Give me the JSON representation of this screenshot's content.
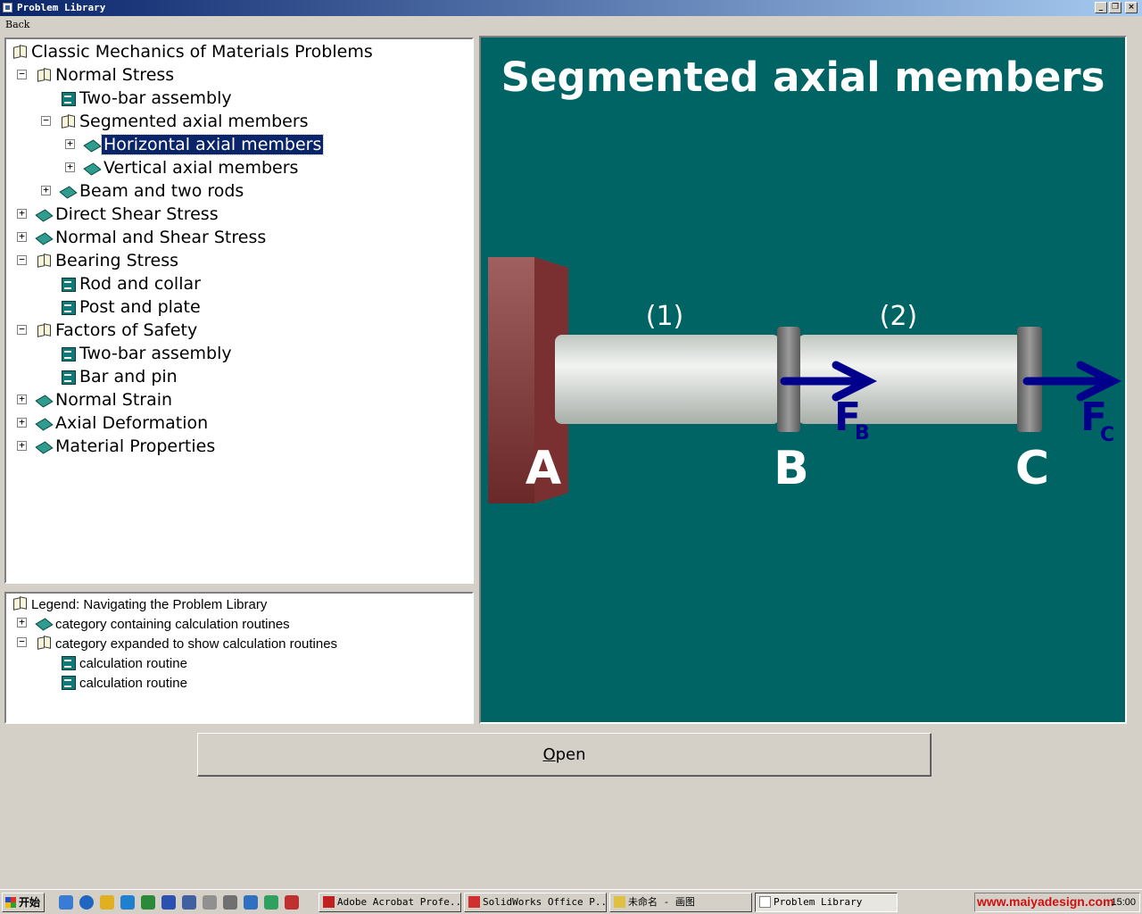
{
  "window": {
    "title": "Problem Library"
  },
  "menu": {
    "back": "Back"
  },
  "tree": [
    {
      "label": "Classic Mechanics of Materials Problems",
      "icon": "book-open",
      "expander": "",
      "level": 0
    },
    {
      "label": "Normal Stress",
      "icon": "book-open",
      "expander": "minus",
      "level": 1
    },
    {
      "label": "Two-bar assembly",
      "icon": "doc",
      "expander": "",
      "level": 2
    },
    {
      "label": "Segmented axial members",
      "icon": "book-open",
      "expander": "minus",
      "level": 2
    },
    {
      "label": "Horizontal axial members",
      "icon": "book-closed",
      "expander": "plus",
      "level": 3,
      "selected": true
    },
    {
      "label": "Vertical axial members",
      "icon": "book-closed",
      "expander": "plus",
      "level": 3
    },
    {
      "label": "Beam and two rods",
      "icon": "book-closed",
      "expander": "plus",
      "level": 2
    },
    {
      "label": "Direct Shear Stress",
      "icon": "book-closed",
      "expander": "plus",
      "level": 1
    },
    {
      "label": "Normal and Shear Stress",
      "icon": "book-closed",
      "expander": "plus",
      "level": 1
    },
    {
      "label": "Bearing Stress",
      "icon": "book-open",
      "expander": "minus",
      "level": 1
    },
    {
      "label": "Rod and collar",
      "icon": "doc",
      "expander": "",
      "level": 2
    },
    {
      "label": "Post and plate",
      "icon": "doc",
      "expander": "",
      "level": 2
    },
    {
      "label": "Factors of Safety",
      "icon": "book-open",
      "expander": "minus",
      "level": 1
    },
    {
      "label": "Two-bar assembly",
      "icon": "doc",
      "expander": "",
      "level": 2
    },
    {
      "label": "Bar and pin",
      "icon": "doc",
      "expander": "",
      "level": 2
    },
    {
      "label": "Normal Strain",
      "icon": "book-closed",
      "expander": "plus",
      "level": 1
    },
    {
      "label": "Axial Deformation",
      "icon": "book-closed",
      "expander": "plus",
      "level": 1
    },
    {
      "label": "Material Properties",
      "icon": "book-closed",
      "expander": "plus",
      "level": 1
    }
  ],
  "legend": [
    {
      "label": "Legend:  Navigating the Problem Library",
      "icon": "book-open",
      "expander": "",
      "level": 0
    },
    {
      "label": "category containing calculation routines",
      "icon": "book-closed",
      "expander": "plus",
      "level": 1
    },
    {
      "label": "category expanded to show calculation routines",
      "icon": "book-open",
      "expander": "minus",
      "level": 1
    },
    {
      "label": "calculation routine",
      "icon": "doc",
      "expander": "",
      "level": 2
    },
    {
      "label": "calculation routine",
      "icon": "doc",
      "expander": "",
      "level": 2
    }
  ],
  "diagram": {
    "title": "Segmented axial members",
    "segment1": "(1)",
    "segment2": "(2)",
    "point_a": "A",
    "point_b": "B",
    "point_c": "C",
    "force_b": "F",
    "force_b_sub": "B",
    "force_c": "F",
    "force_c_sub": "C",
    "colors": {
      "background": "#006464",
      "arrow": "#00008c",
      "wall": "#8a3a3a",
      "bar": "#d8ddd8"
    }
  },
  "buttons": {
    "open_prefix": "",
    "open_underlined": "O",
    "open_rest": "pen"
  },
  "taskbar": {
    "start": "开始",
    "tasks": [
      {
        "label": "Adobe Acrobat Profe...",
        "icon": "acrobat-icon"
      },
      {
        "label": "SolidWorks Office P...",
        "icon": "solidworks-icon"
      },
      {
        "label": "未命名 - 画图",
        "icon": "paint-icon"
      },
      {
        "label": "Problem Library",
        "icon": "problem-library-icon",
        "active": true
      }
    ],
    "tray_text": "www.maiyadesign.com",
    "clock": "15:00"
  }
}
